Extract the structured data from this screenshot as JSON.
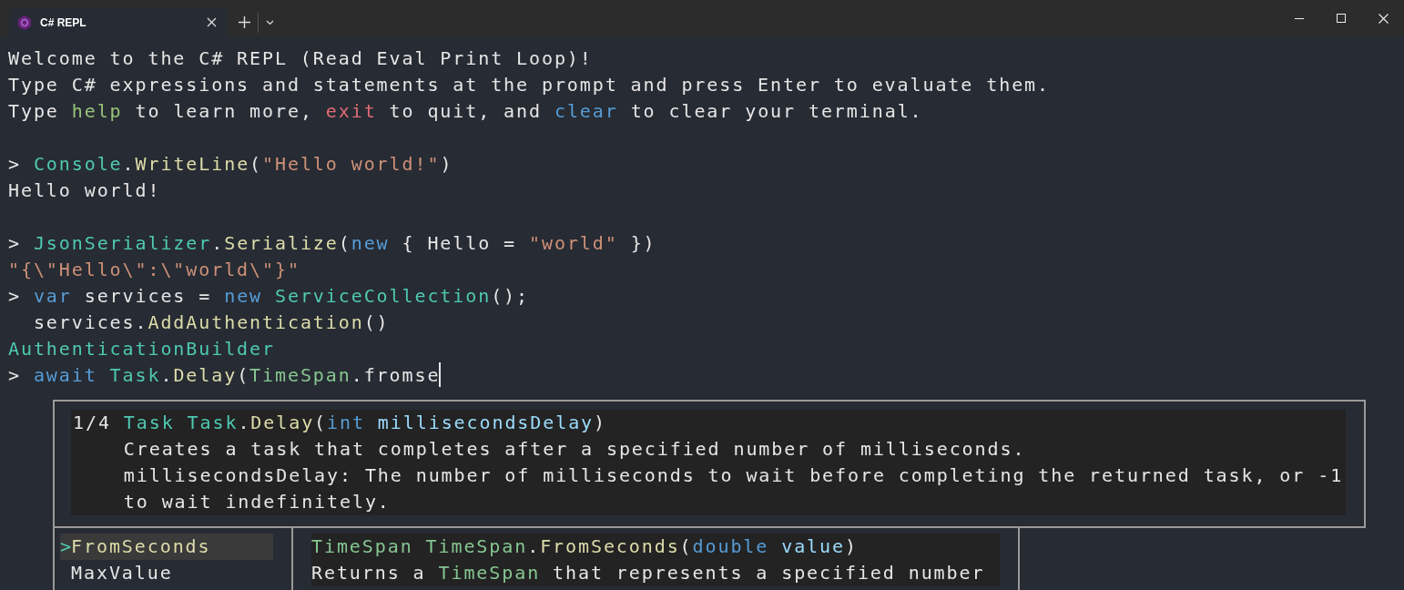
{
  "window": {
    "tab": {
      "title": "C# REPL"
    }
  },
  "terminal": {
    "blocks": [
      {
        "lines": [
          {
            "segments": [
              {
                "kind": "plain",
                "text": "Welcome to the C# REPL (Read Eval Print Loop)!"
              }
            ]
          },
          {
            "segments": [
              {
                "kind": "plain",
                "text": "Type C# expressions and statements at the prompt and press Enter to evaluate them."
              }
            ]
          },
          {
            "segments": [
              {
                "kind": "plain",
                "text": "Type "
              },
              {
                "kind": "command-help",
                "text": "help"
              },
              {
                "kind": "plain",
                "text": " to learn more, "
              },
              {
                "kind": "command-exit",
                "text": "exit"
              },
              {
                "kind": "plain",
                "text": " to quit, and "
              },
              {
                "kind": "keyword",
                "text": "clear"
              },
              {
                "kind": "plain",
                "text": " to clear your terminal."
              }
            ]
          }
        ]
      },
      {
        "lines": [
          {
            "segments": [
              {
                "kind": "plain",
                "text": "> "
              },
              {
                "kind": "type",
                "text": "Console"
              },
              {
                "kind": "plain",
                "text": "."
              },
              {
                "kind": "method",
                "text": "WriteLine"
              },
              {
                "kind": "plain",
                "text": "("
              },
              {
                "kind": "string",
                "text": "\"Hello world!\""
              },
              {
                "kind": "plain",
                "text": ")"
              }
            ]
          },
          {
            "segments": [
              {
                "kind": "plain",
                "text": "Hello world!"
              }
            ]
          }
        ]
      },
      {
        "lines": [
          {
            "segments": [
              {
                "kind": "plain",
                "text": "> "
              },
              {
                "kind": "type",
                "text": "JsonSerializer"
              },
              {
                "kind": "plain",
                "text": "."
              },
              {
                "kind": "method",
                "text": "Serialize"
              },
              {
                "kind": "plain",
                "text": "("
              },
              {
                "kind": "keyword",
                "text": "new"
              },
              {
                "kind": "plain",
                "text": " { Hello = "
              },
              {
                "kind": "string",
                "text": "\"world\""
              },
              {
                "kind": "plain",
                "text": " })"
              }
            ]
          },
          {
            "segments": [
              {
                "kind": "string",
                "text": "\"{\\\"Hello\\\":\\\"world\\\"}\""
              }
            ]
          },
          {
            "segments": [
              {
                "kind": "plain",
                "text": "> "
              },
              {
                "kind": "keyword",
                "text": "var"
              },
              {
                "kind": "plain",
                "text": " services = "
              },
              {
                "kind": "keyword",
                "text": "new"
              },
              {
                "kind": "type",
                "text": " ServiceCollection"
              },
              {
                "kind": "plain",
                "text": "();"
              }
            ]
          },
          {
            "segments": [
              {
                "kind": "plain",
                "text": "  services."
              },
              {
                "kind": "method",
                "text": "AddAuthentication"
              },
              {
                "kind": "plain",
                "text": "()"
              }
            ]
          },
          {
            "segments": [
              {
                "kind": "type",
                "text": "AuthenticationBuilder"
              }
            ]
          },
          {
            "cursor": true,
            "segments": [
              {
                "kind": "plain",
                "text": "> "
              },
              {
                "kind": "keyword",
                "text": "await"
              },
              {
                "kind": "type",
                "text": " Task"
              },
              {
                "kind": "plain",
                "text": "."
              },
              {
                "kind": "method",
                "text": "Delay"
              },
              {
                "kind": "plain",
                "text": "("
              },
              {
                "kind": "struct",
                "text": "TimeSpan"
              },
              {
                "kind": "plain",
                "text": ".fromse"
              }
            ]
          }
        ]
      }
    ]
  },
  "signature_help": {
    "counter": "1/4",
    "signature": [
      {
        "kind": "type",
        "text": "Task"
      },
      {
        "kind": "type",
        "text": " Task"
      },
      {
        "kind": "plain",
        "text": "."
      },
      {
        "kind": "method",
        "text": "Delay"
      },
      {
        "kind": "plain",
        "text": "("
      },
      {
        "kind": "keyword",
        "text": "int"
      },
      {
        "kind": "param",
        "text": " millisecondsDelay"
      },
      {
        "kind": "plain",
        "text": ")"
      }
    ],
    "description": [
      "Creates a task that completes after a specified number of milliseconds.",
      "millisecondsDelay: The number of milliseconds to wait before completing the returned task, or -1",
      "to wait indefinitely."
    ]
  },
  "completions": {
    "items": [
      {
        "pointer": ">",
        "label": "FromSeconds",
        "selected": true
      },
      {
        "label": "MaxValue",
        "selected": false
      }
    ],
    "detail": [
      [
        {
          "kind": "struct",
          "text": "TimeSpan"
        },
        {
          "kind": "struct",
          "text": " TimeSpan"
        },
        {
          "kind": "plain",
          "text": "."
        },
        {
          "kind": "method",
          "text": "FromSeconds"
        },
        {
          "kind": "plain",
          "text": "("
        },
        {
          "kind": "keyword",
          "text": "double"
        },
        {
          "kind": "param",
          "text": " value"
        },
        {
          "kind": "plain",
          "text": ")"
        }
      ],
      [
        {
          "kind": "plain",
          "text": "Returns a "
        },
        {
          "kind": "struct",
          "text": "TimeSpan"
        },
        {
          "kind": "plain",
          "text": " that represents a specified number"
        }
      ]
    ]
  }
}
